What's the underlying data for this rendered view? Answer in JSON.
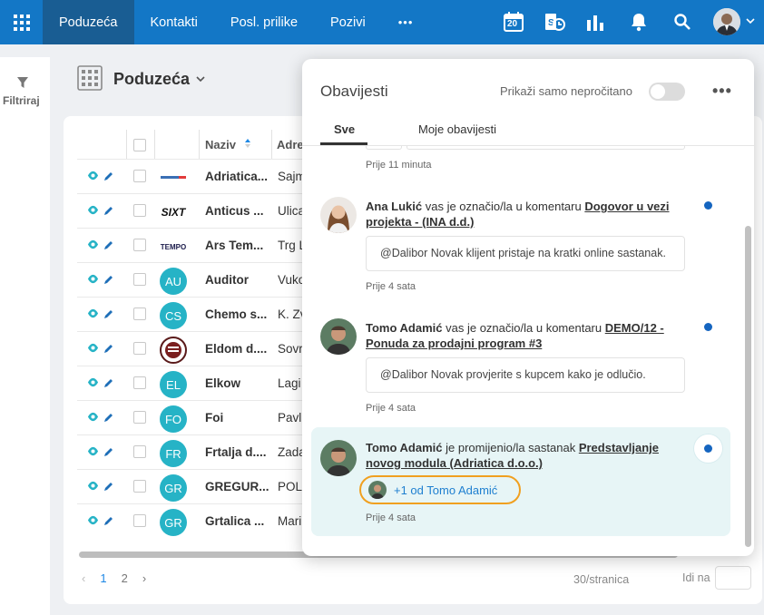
{
  "topbar": {
    "tabs": [
      {
        "label": "Poduzeća"
      },
      {
        "label": "Kontakti"
      },
      {
        "label": "Posl. prilike"
      },
      {
        "label": "Pozivi"
      }
    ],
    "more": "•••",
    "calendar_day": "20"
  },
  "sidebar": {
    "filter_label": "Filtriraj"
  },
  "page": {
    "title": "Poduzeća",
    "chevron": "⌵"
  },
  "table": {
    "col_name": "Naziv",
    "col_address": "Adre",
    "rows": [
      {
        "name": "Adriatica...",
        "address": "Sajm",
        "logo": "brand",
        "initials": ""
      },
      {
        "name": "Anticus ...",
        "address": "Ulica",
        "logo": "sixt",
        "initials": "SIXT"
      },
      {
        "name": "Ars Tem...",
        "address": "Trg L",
        "logo": "tempo",
        "initials": "TEMPO"
      },
      {
        "name": "Auditor",
        "address": "Vuko",
        "logo": "initials",
        "initials": "AU"
      },
      {
        "name": "Chemo s...",
        "address": "K. Zv",
        "logo": "initials",
        "initials": "CS"
      },
      {
        "name": "Eldom d....",
        "address": "Sovr",
        "logo": "seal",
        "initials": ""
      },
      {
        "name": "Elkow",
        "address": "Lagi",
        "logo": "initials",
        "initials": "EL"
      },
      {
        "name": "Foi",
        "address": "Pavl",
        "logo": "initials",
        "initials": "FO"
      },
      {
        "name": "Frtalja d....",
        "address": "Zada",
        "logo": "initials",
        "initials": "FR"
      },
      {
        "name": "GREGUR...",
        "address": "POL",
        "logo": "initials",
        "initials": "GR"
      },
      {
        "name": "Grtalica ...",
        "address": "Mari",
        "logo": "initials",
        "initials": "GR"
      }
    ]
  },
  "pager": {
    "prev": "‹",
    "page1": "1",
    "page2": "2",
    "next": "›",
    "per_page": "30/stranica",
    "goto_label": "Idi na"
  },
  "notifications": {
    "title": "Obavijesti",
    "toggle_label": "Prikaži samo nepročitano",
    "more": "•••",
    "tabs": {
      "all": "Sve",
      "mine": "Moje obavijesti"
    },
    "top_time": "Prije 11 minuta",
    "items": [
      {
        "author": "Ana Lukić",
        "action": " vas je označio/la u komentaru ",
        "link": "Dogovor u vezi projekta - (INA d.d.)",
        "quote": "@Dalibor Novak klijent pristaje na kratki online sastanak.",
        "time": "Prije 4 sata"
      },
      {
        "author": "Tomo Adamić",
        "action": " vas je označio/la u komentaru ",
        "link": "DEMO/12 - Ponuda za prodajni program #3",
        "quote": "@Dalibor Novak provjerite s kupcem kako je odlučio.",
        "time": "Prije 4 sata"
      },
      {
        "author": "Tomo Adamić",
        "action": " je promijenio/la sastanak ",
        "link": "Predstavljanje novog modula (Adriatica d.o.o.)",
        "chip": "+1 od Tomo Adamić",
        "time": "Prije 4 sata"
      }
    ]
  },
  "colors": {
    "topbar": "#1377c6",
    "active_tab": "#195d93",
    "teal": "#26b3c6",
    "unread_dot": "#1565c0",
    "highlight_bg": "#e7f5f6",
    "chip_border": "#f0a020",
    "chip_text": "#1e7fd0"
  }
}
